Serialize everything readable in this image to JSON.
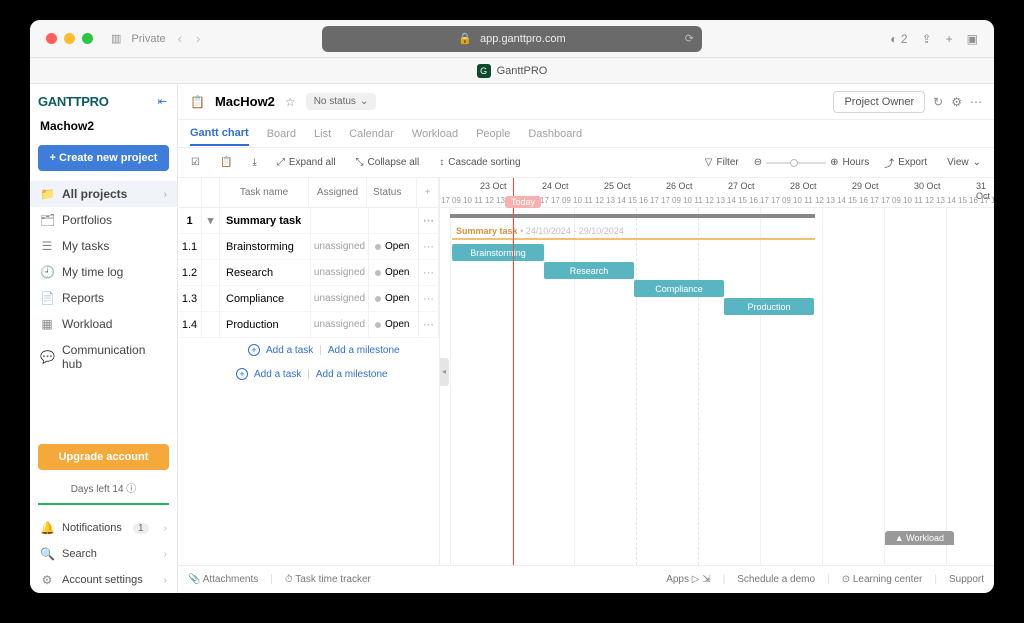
{
  "browser": {
    "private_label": "Private",
    "url": "app.ganttpro.com",
    "shield_count": "2",
    "tab_title": "GanttPRO"
  },
  "sidebar": {
    "logo": "GANTTPRO",
    "workspace": "Machow2",
    "new_project": "+  Create new project",
    "items": [
      {
        "label": "All projects",
        "icon": "📁",
        "active": true,
        "chev": true
      },
      {
        "label": "Portfolios",
        "icon": "🗂"
      },
      {
        "label": "My tasks",
        "icon": "☰"
      },
      {
        "label": "My time log",
        "icon": "🕘"
      },
      {
        "label": "Reports",
        "icon": "📄"
      },
      {
        "label": "Workload",
        "icon": "▦"
      },
      {
        "label": "Communication hub",
        "icon": "💬"
      }
    ],
    "upgrade": "Upgrade account",
    "days_left": "Days left 14",
    "bottom": [
      {
        "label": "Notifications",
        "icon": "🔔",
        "badge": "1",
        "chev": true
      },
      {
        "label": "Search",
        "icon": "🔍",
        "chev": true
      },
      {
        "label": "Account settings",
        "icon": "⚙",
        "chev": true
      }
    ]
  },
  "header": {
    "project": "MacHow2",
    "nostatus": "No status",
    "project_owner": "Project Owner"
  },
  "tabs": [
    "Gantt chart",
    "Board",
    "List",
    "Calendar",
    "Workload",
    "People",
    "Dashboard"
  ],
  "toolbar": {
    "expand": "Expand all",
    "collapse": "Collapse all",
    "cascade": "Cascade sorting",
    "filter": "Filter",
    "hours": "Hours",
    "export": "Export",
    "view": "View"
  },
  "tasklist": {
    "cols": {
      "name": "Task name",
      "assigned": "Assigned",
      "status": "Status"
    },
    "summary": {
      "num": "1",
      "name": "Summary task"
    },
    "rows": [
      {
        "num": "1.1",
        "name": "Brainstorming",
        "assigned": "unassigned",
        "status": "Open"
      },
      {
        "num": "1.2",
        "name": "Research",
        "assigned": "unassigned",
        "status": "Open"
      },
      {
        "num": "1.3",
        "name": "Compliance",
        "assigned": "unassigned",
        "status": "Open"
      },
      {
        "num": "1.4",
        "name": "Production",
        "assigned": "unassigned",
        "status": "Open"
      }
    ],
    "addtask": "Add a task",
    "addmilestone": "Add a milestone"
  },
  "gantt": {
    "days": [
      "23 Oct",
      "24 Oct",
      "25 Oct",
      "26 Oct",
      "27 Oct",
      "28 Oct",
      "29 Oct",
      "30 Oct",
      "31 Oct"
    ],
    "hours_seq": [
      "17",
      "09",
      "10",
      "11",
      "12",
      "13",
      "14",
      "15",
      "16",
      "17"
    ],
    "today": "Today",
    "summary_label": "Summary task",
    "summary_dates": "24/10/2024 - 29/10/2024",
    "bars": [
      {
        "name": "Brainstorming"
      },
      {
        "name": "Research"
      },
      {
        "name": "Compliance"
      },
      {
        "name": "Production"
      }
    ],
    "workload_btn": "▲ Workload"
  },
  "footer": {
    "attachments": "Attachments",
    "tracker": "Task time tracker",
    "apps": "Apps",
    "demo": "Schedule a demo",
    "learning": "Learning center",
    "support": "Support"
  }
}
